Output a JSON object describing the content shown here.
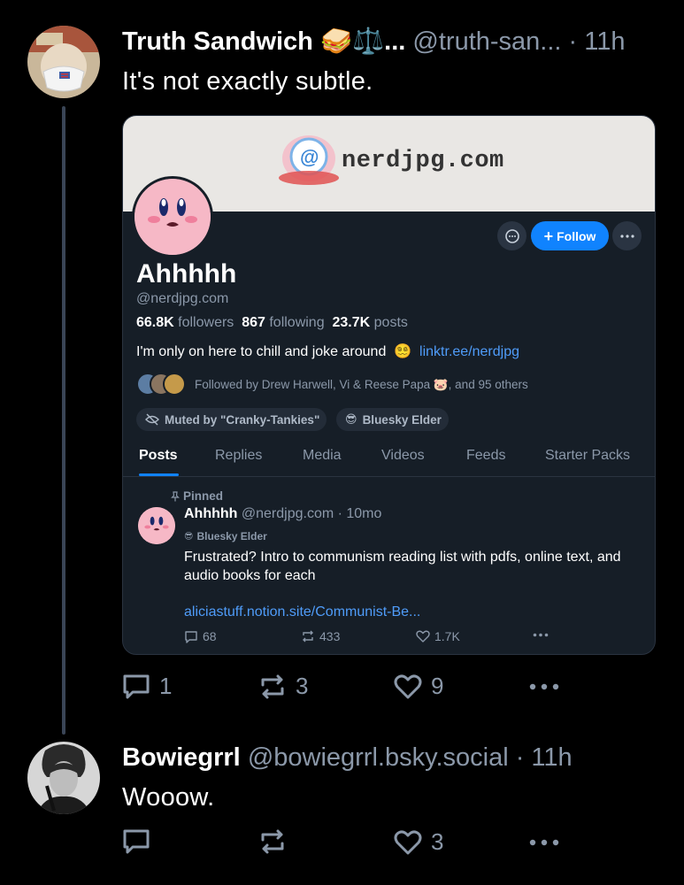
{
  "post1": {
    "display_name": "Truth Sandwich 🥪⚖️...",
    "handle": "@truth-san...",
    "time": "· 11h",
    "text": "It's not exactly subtle.",
    "replies": "1",
    "reposts": "3",
    "likes": "9"
  },
  "embed": {
    "banner_text": "nerdjpg.com",
    "follow_label": "Follow",
    "name": "Ahhhhh",
    "handle": "@nerdjpg.com",
    "followers_count": "66.8K",
    "followers_label": "followers",
    "following_count": "867",
    "following_label": "following",
    "posts_count": "23.7K",
    "posts_label": "posts",
    "bio": "I'm only on here to chill and joke around",
    "bio_emoji": "😵‍💫",
    "bio_link": "linktr.ee/nerdjpg",
    "followed_by": "Followed by Drew Harwell, Vi & Reese Papa 🐷, and 95 others",
    "labels": [
      "Muted by \"Cranky-Tankies\"",
      "Bluesky Elder"
    ],
    "tabs": [
      "Posts",
      "Replies",
      "Media",
      "Videos",
      "Feeds",
      "Starter Packs"
    ],
    "pinned_label": "Pinned",
    "pinned_post": {
      "name": "Ahhhhh",
      "handle_time": "@nerdjpg.com · 10mo",
      "badge": "Bluesky Elder",
      "text": "Frustrated? Intro to communism reading list with pdfs, online text, and audio books for each",
      "link": "aliciastuff.notion.site/Communist-Be...",
      "replies": "68",
      "reposts": "433",
      "likes": "1.7K"
    }
  },
  "post2": {
    "display_name": "Bowiegrrl",
    "handle": "@bowiegrrl.bsky.social",
    "time": "· 11h",
    "text": "Wooow.",
    "likes": "3"
  },
  "colors": {
    "background": "#000000",
    "muted_text": "#8b98a9",
    "accent": "#1083fe",
    "link": "#4f9cf9",
    "card_bg": "#161e27"
  }
}
